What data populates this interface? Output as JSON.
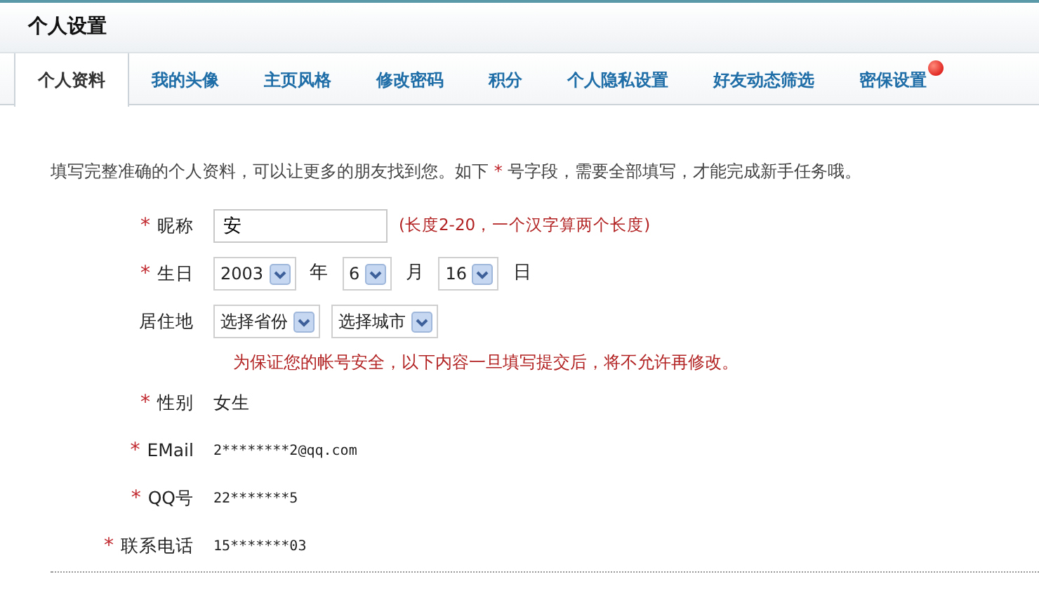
{
  "header": {
    "title": "个人设置"
  },
  "tabs": [
    {
      "label": "个人资料",
      "selected": true,
      "badge": false
    },
    {
      "label": "我的头像",
      "selected": false,
      "badge": false
    },
    {
      "label": "主页风格",
      "selected": false,
      "badge": false
    },
    {
      "label": "修改密码",
      "selected": false,
      "badge": false
    },
    {
      "label": "积分",
      "selected": false,
      "badge": false
    },
    {
      "label": "个人隐私设置",
      "selected": false,
      "badge": false
    },
    {
      "label": "好友动态筛选",
      "selected": false,
      "badge": false
    },
    {
      "label": "密保设置",
      "selected": false,
      "badge": true
    }
  ],
  "intro": {
    "before": "填写完整准确的个人资料，可以让更多的朋友找到您。如下",
    "mark": "*",
    "after": "号字段，需要全部填写，才能完成新手任务哦。"
  },
  "fields": [
    {
      "kind": "text",
      "mark": "*",
      "label": "昵称",
      "value": "安",
      "hint": "(长度2-20，一个汉字算两个长度)"
    },
    {
      "kind": "selects",
      "mark": "*",
      "label": "生日",
      "selects": [
        {
          "value": "2003",
          "unit": "年"
        },
        {
          "value": "6",
          "unit": "月"
        },
        {
          "value": "16",
          "unit": "日"
        }
      ]
    },
    {
      "kind": "selects",
      "label": "居住地",
      "selects": [
        {
          "value": "选择省份"
        },
        {
          "value": "选择城市"
        }
      ]
    },
    {
      "kind": "notice",
      "text": "为保证您的帐号安全，以下内容一旦填写提交后，将不允许再修改。"
    },
    {
      "kind": "static",
      "mark": "*",
      "label": "性别",
      "value": "女生"
    },
    {
      "kind": "static",
      "mark": "*",
      "label": "EMail",
      "value": "2********2@qq.com",
      "mono": true
    },
    {
      "kind": "static",
      "mark": "*",
      "label": "QQ号",
      "value": "22*******5",
      "mono": true
    },
    {
      "kind": "static",
      "mark": "*",
      "label": "联系电话",
      "value": "15*******03",
      "mono": true
    }
  ]
}
